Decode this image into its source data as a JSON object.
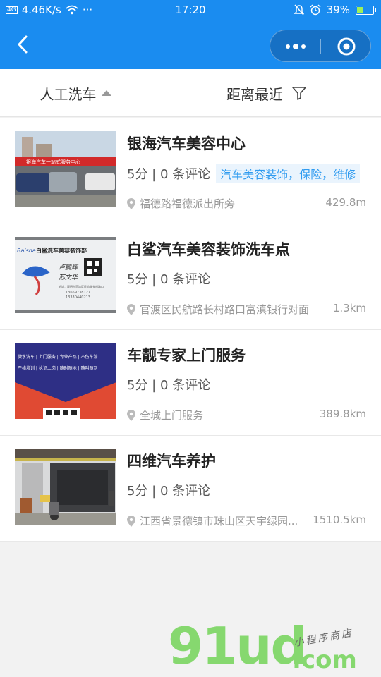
{
  "status_bar": {
    "network": "4G",
    "speed": "4.46K/s",
    "more": "···",
    "time": "17:20",
    "battery": "39%",
    "battery_level": 0.39
  },
  "filters": [
    {
      "label": "人工洗车",
      "icon": "caret-up-icon"
    },
    {
      "label": "距离最近",
      "icon": "filter-icon"
    }
  ],
  "listings": [
    {
      "title": "银海汽车美容中心",
      "rating": "5分 | 0 条评论",
      "tag": "汽车美容装饰，保险，维修",
      "address": "福德路福德派出所旁",
      "distance": "429.8m"
    },
    {
      "title": "白鲨汽车美容装饰洗车点",
      "rating": "5分 | 0 条评论",
      "address": "官渡区民航路长村路口富滇银行对面",
      "distance": "1.3km"
    },
    {
      "title": "车靓专家上门服务",
      "rating": "5分 | 0 条评论",
      "address": "全城上门服务",
      "distance": "389.8km"
    },
    {
      "title": "四维汽车养护",
      "rating": "5分 | 0 条评论",
      "address": "江西省景德镇市珠山区天宇绿园...",
      "distance": "1510.5km"
    }
  ],
  "thumb_text": {
    "banner1": "银海汽车一站式服务中心",
    "card_brand": "Baisha",
    "card_title": "白鲨洗车美容装饰部",
    "card_name1": "卢鹏辉",
    "card_name2": "苏文华",
    "card_addr": "地址：昆明市官渡区民航路长村路口",
    "card_phone1": "13669738127",
    "card_phone2": "13330440213",
    "flyer_line1": "微水洗车 | 上门服务 | 专业产品 | 不伤车漆",
    "flyer_line2": "严格培训 | 执证上岗 | 随时随地 | 随叫随到"
  },
  "watermark": {
    "main": "91ud",
    "suffix": ".com",
    "small": "小程序商店"
  }
}
